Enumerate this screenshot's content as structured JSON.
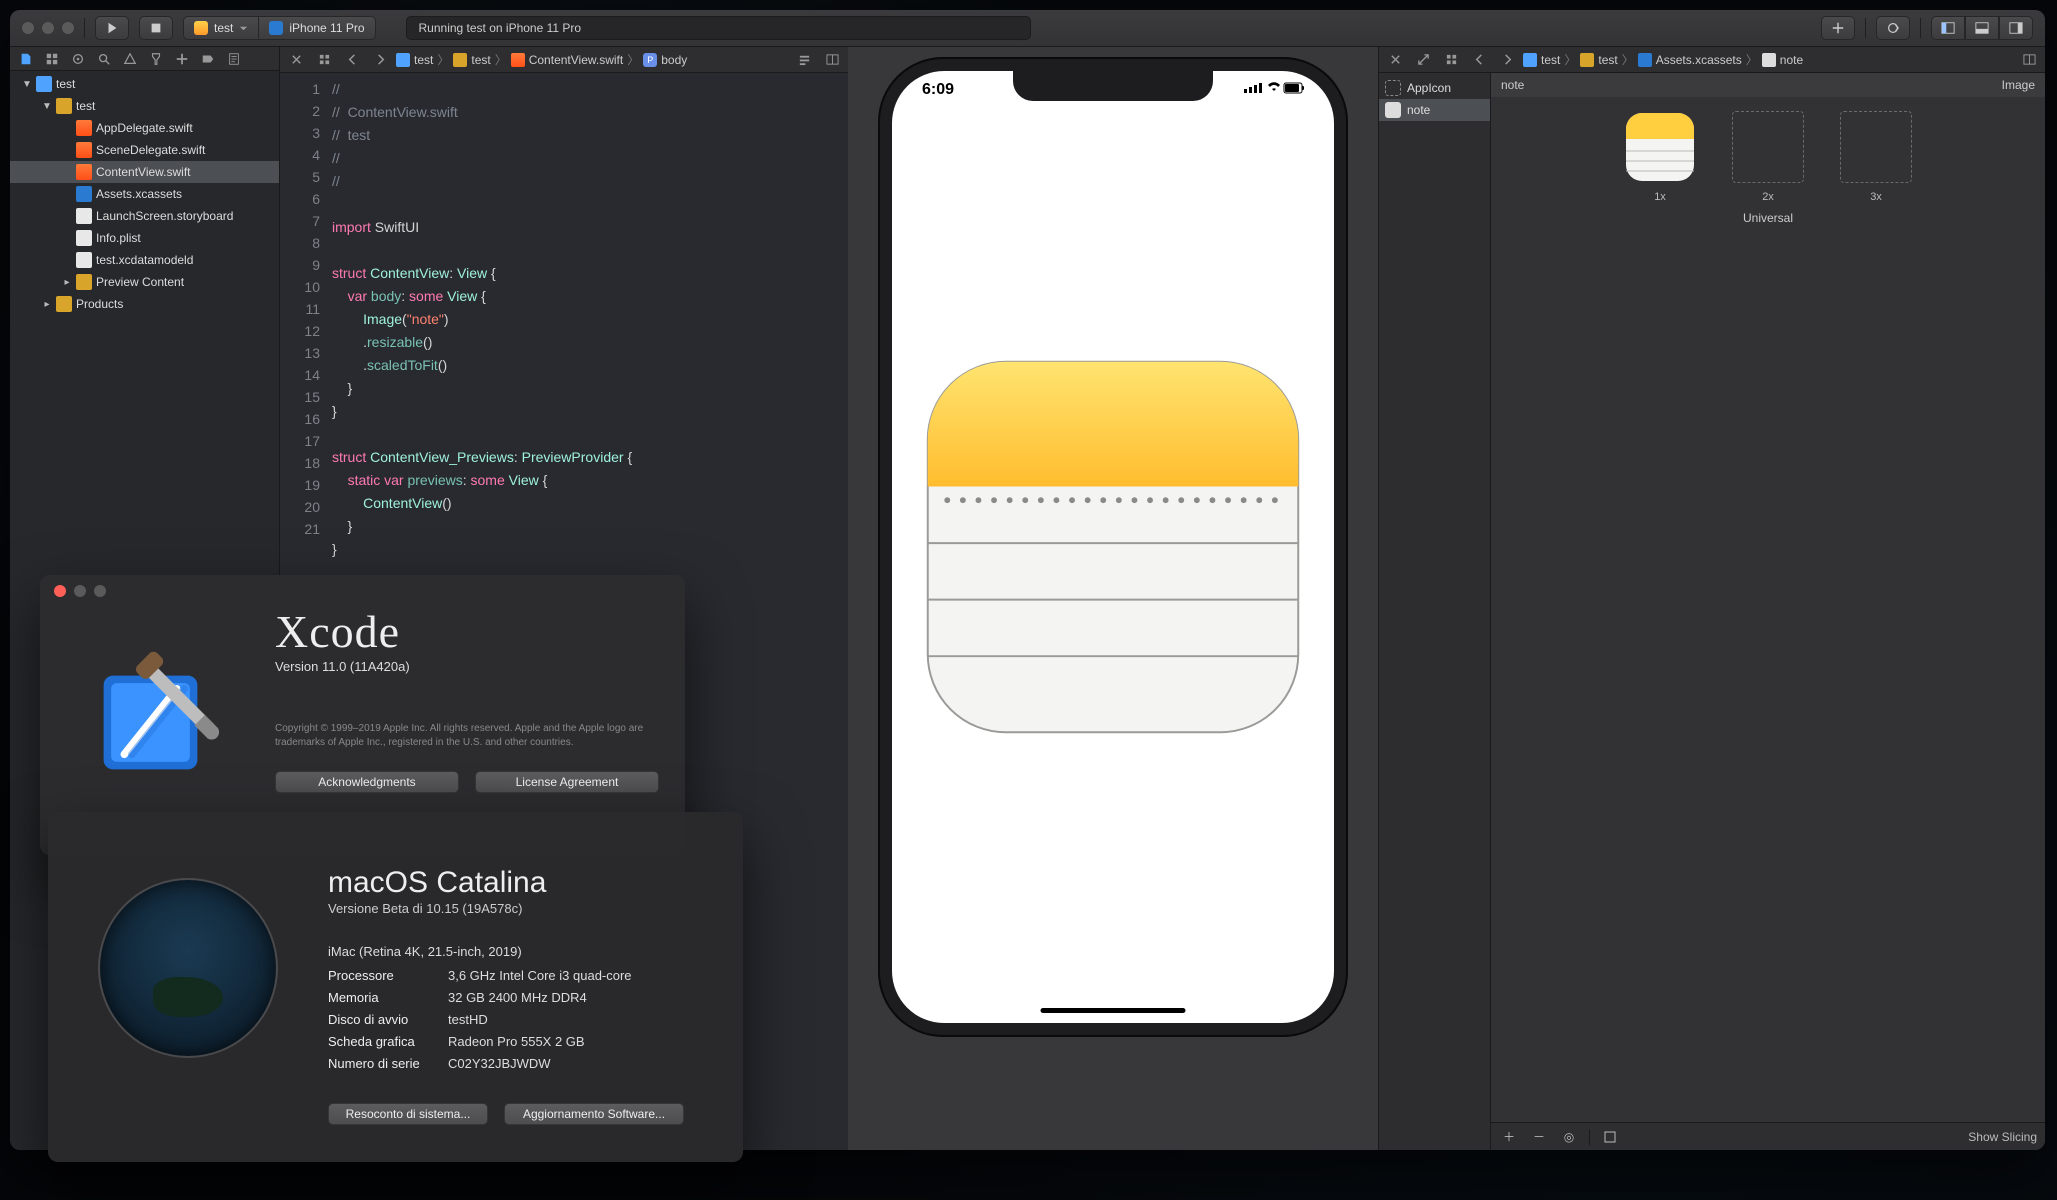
{
  "titlebar": {
    "scheme_target": "test",
    "scheme_device": "iPhone 11 Pro",
    "activity": "Running test on iPhone 11 Pro"
  },
  "jumpbar": {
    "seg1": "test",
    "seg2": "test",
    "seg3": "ContentView.swift",
    "seg4": "body"
  },
  "tree": {
    "root": "test",
    "group": "test",
    "files": {
      "appdelegate": "AppDelegate.swift",
      "scenedelegate": "SceneDelegate.swift",
      "contentview": "ContentView.swift",
      "assets": "Assets.xcassets",
      "launchscreen": "LaunchScreen.storyboard",
      "info": "Info.plist",
      "model": "test.xcdatamodeld",
      "preview": "Preview Content"
    },
    "products": "Products"
  },
  "code": {
    "l1": "//",
    "l2_a": "//  ",
    "l2_b": "ContentView.swift",
    "l3_a": "//  ",
    "l3_b": "test",
    "l4": "//",
    "l5": "//",
    "l6": "",
    "l7_a": "import",
    "l7_b": " SwiftUI",
    "l8": "",
    "l9_a": "struct",
    "l9_b": " ",
    "l9_c": "ContentView",
    "l9_d": ": ",
    "l9_e": "View",
    "l9_f": " {",
    "l10_a": "    ",
    "l10_b": "var",
    "l10_c": " ",
    "l10_d": "body",
    "l10_e": ": ",
    "l10_f": "some",
    "l10_g": " ",
    "l10_h": "View",
    "l10_i": " {",
    "l11_a": "        ",
    "l11_b": "Image",
    "l11_c": "(",
    "l11_d": "\"note\"",
    "l11_e": ")",
    "l12_a": "        .",
    "l12_b": "resizable",
    "l12_c": "()",
    "l13_a": "        .",
    "l13_b": "scaledToFit",
    "l13_c": "()",
    "l14": "    }",
    "l15": "}",
    "l16": "",
    "l17_a": "struct",
    "l17_b": " ",
    "l17_c": "ContentView_Previews",
    "l17_d": ": ",
    "l17_e": "PreviewProvider",
    "l17_f": " {",
    "l18_a": "    ",
    "l18_b": "static",
    "l18_c": " ",
    "l18_d": "var",
    "l18_e": " ",
    "l18_f": "previews",
    "l18_g": ": ",
    "l18_h": "some",
    "l18_i": " ",
    "l18_j": "View",
    "l18_k": " {",
    "l19_a": "        ",
    "l19_b": "ContentView",
    "l19_c": "()",
    "l20": "    }",
    "l21": "}"
  },
  "gutter": [
    "1",
    "2",
    "3",
    "4",
    "5",
    "6",
    "7",
    "8",
    "9",
    "10",
    "11",
    "12",
    "13",
    "14",
    "15",
    "16",
    "17",
    "18",
    "19",
    "20",
    "21"
  ],
  "phone": {
    "time": "6:09"
  },
  "assets_jump": {
    "seg1": "test",
    "seg2": "test",
    "seg3": "Assets.xcassets",
    "seg4": "note"
  },
  "assets": {
    "list": {
      "appicon": "AppIcon",
      "note": "note"
    },
    "detail": {
      "title": "note",
      "kind": "Image",
      "s1": "1x",
      "s2": "2x",
      "s3": "3x",
      "universal": "Universal"
    },
    "footer": {
      "slice": "Show Slicing"
    }
  },
  "about_xcode": {
    "title": "Xcode",
    "version": "Version 11.0 (11A420a)",
    "copyright": "Copyright © 1999–2019 Apple Inc. All rights reserved. Apple and the Apple logo are trademarks of Apple Inc., registered in the U.S. and other countries.",
    "ack": "Acknowledgments",
    "lic": "License Agreement"
  },
  "about_mac": {
    "title_a": "macOS ",
    "title_b": "Catalina",
    "sub": "Versione Beta di 10.15 (19A578c)",
    "model": "iMac (Retina 4K, 21.5-inch, 2019)",
    "rows": {
      "cpu_k": "Processore",
      "cpu_v": "3,6 GHz Intel Core i3 quad-core",
      "mem_k": "Memoria",
      "mem_v": "32 GB 2400 MHz DDR4",
      "disk_k": "Disco di avvio",
      "disk_v": "testHD",
      "gpu_k": "Scheda grafica",
      "gpu_v": "Radeon Pro 555X 2 GB",
      "ser_k": "Numero di serie",
      "ser_v": "C02Y32JBJWDW"
    },
    "btn1": "Resoconto di sistema...",
    "btn2": "Aggiornamento Software..."
  }
}
